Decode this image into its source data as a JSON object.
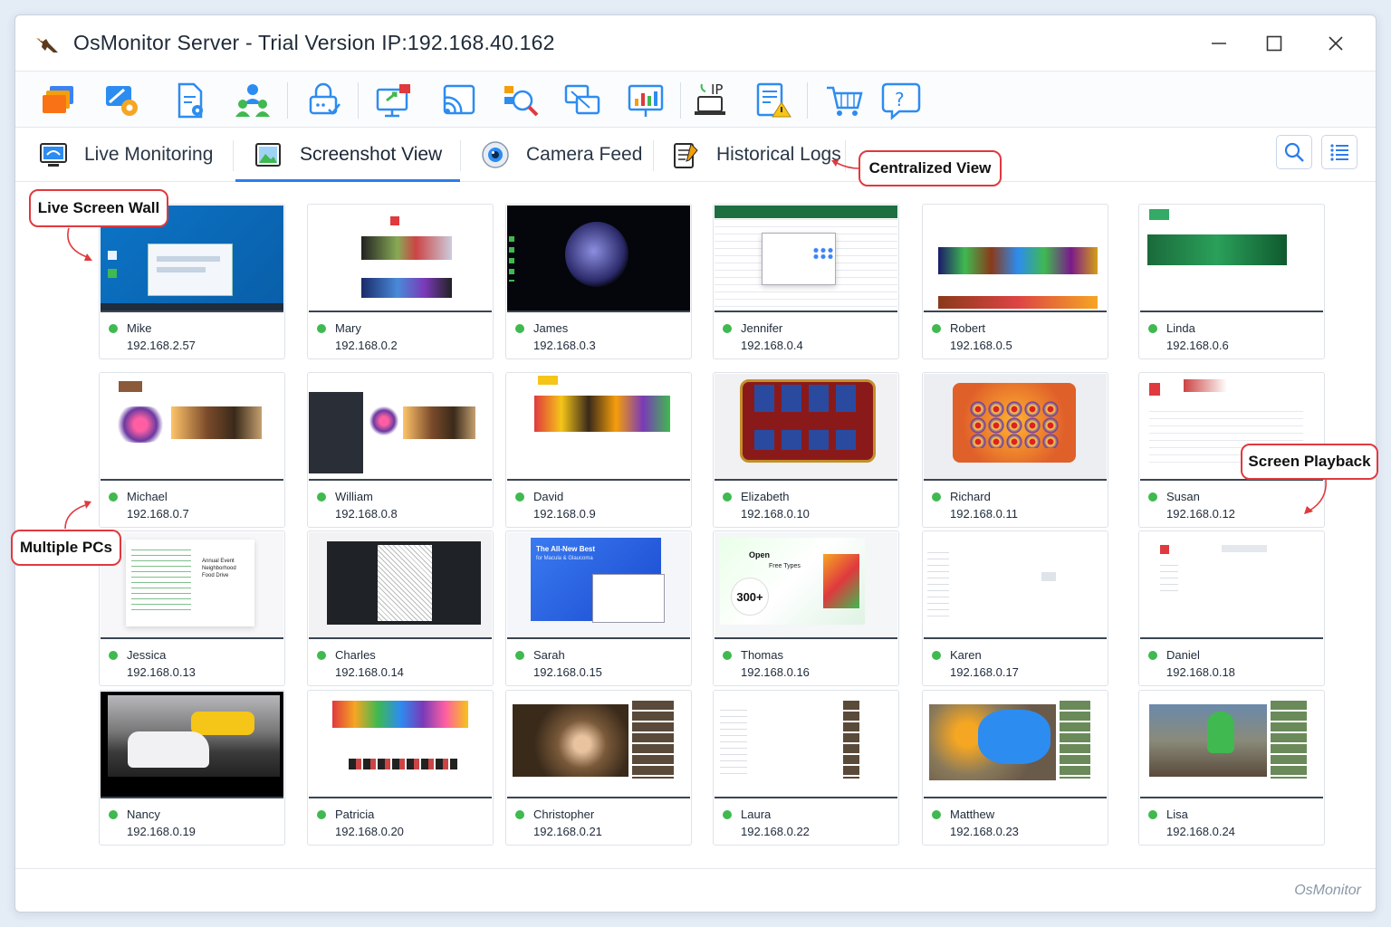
{
  "window": {
    "title": "OsMonitor Server - Trial Version IP:192.168.40.162",
    "minimize_icon": "minimize-icon",
    "maximize_icon": "maximize-icon",
    "close_icon": "close-icon"
  },
  "toolbar": {
    "buttons": [
      {
        "icon": "windows-stack-icon"
      },
      {
        "icon": "magic-settings-icon"
      },
      {
        "icon": "document-settings-icon"
      },
      {
        "icon": "users-icon"
      },
      {
        "icon": "lock-check-icon"
      },
      {
        "icon": "remote-desktop-icon"
      },
      {
        "icon": "broadcast-icon"
      },
      {
        "icon": "search-analyze-icon"
      },
      {
        "icon": "screens-icon"
      },
      {
        "icon": "monitor-chart-icon"
      },
      {
        "icon": "ip-monitor-icon"
      },
      {
        "icon": "log-warning-icon"
      },
      {
        "icon": "cart-icon"
      },
      {
        "icon": "help-icon"
      }
    ],
    "ip_label": "IP",
    "help_label": "?"
  },
  "tabs": [
    {
      "label": "Live Monitoring",
      "icon": "live-monitor-icon"
    },
    {
      "label": "Screenshot View",
      "icon": "picture-icon",
      "active": true
    },
    {
      "label": "Camera Feed",
      "icon": "camera-icon"
    },
    {
      "label": "Historical Logs",
      "icon": "logbook-icon"
    }
  ],
  "tools": {
    "search_icon": "search-icon",
    "list_icon": "list-view-icon"
  },
  "callouts": {
    "centralized": "Centralized View",
    "live_wall": "Live Screen Wall",
    "playback": "Screen Playback",
    "multiple": "Multiple PCs"
  },
  "accent": "#2b7de9",
  "status_online_color": "#3fb950",
  "callout_color": "#e0393e",
  "computers": [
    {
      "name": "Mike",
      "ip": "192.168.2.57",
      "theme": "desktop"
    },
    {
      "name": "Mary",
      "ip": "192.168.0.2",
      "theme": "web"
    },
    {
      "name": "James",
      "ip": "192.168.0.3",
      "theme": "dark-flower"
    },
    {
      "name": "Jennifer",
      "ip": "192.168.0.4",
      "theme": "excel"
    },
    {
      "name": "Robert",
      "ip": "192.168.0.5",
      "theme": "store"
    },
    {
      "name": "Linda",
      "ip": "192.168.0.6",
      "theme": "green-web"
    },
    {
      "name": "Michael",
      "ip": "192.168.0.7",
      "theme": "drone"
    },
    {
      "name": "William",
      "ip": "192.168.0.8",
      "theme": "drone-dark"
    },
    {
      "name": "David",
      "ip": "192.168.0.9",
      "theme": "games"
    },
    {
      "name": "Elizabeth",
      "ip": "192.168.0.10",
      "theme": "poker"
    },
    {
      "name": "Richard",
      "ip": "192.168.0.11",
      "theme": "slots"
    },
    {
      "name": "Susan",
      "ip": "192.168.0.12",
      "theme": "pdf"
    },
    {
      "name": "Jessica",
      "ip": "192.168.0.13",
      "theme": "doc"
    },
    {
      "name": "Charles",
      "ip": "192.168.0.14",
      "theme": "coloring"
    },
    {
      "name": "Sarah",
      "ip": "192.168.0.15",
      "theme": "blue-ad"
    },
    {
      "name": "Thomas",
      "ip": "192.168.0.16",
      "theme": "fonts"
    },
    {
      "name": "Karen",
      "ip": "192.168.0.17",
      "theme": "blank"
    },
    {
      "name": "Daniel",
      "ip": "192.168.0.18",
      "theme": "blank2"
    },
    {
      "name": "Nancy",
      "ip": "192.168.0.19",
      "theme": "car"
    },
    {
      "name": "Patricia",
      "ip": "192.168.0.20",
      "theme": "colorful"
    },
    {
      "name": "Christopher",
      "ip": "192.168.0.21",
      "theme": "video"
    },
    {
      "name": "Laura",
      "ip": "192.168.0.22",
      "theme": "youtube"
    },
    {
      "name": "Matthew",
      "ip": "192.168.0.23",
      "theme": "blue-shark"
    },
    {
      "name": "Lisa",
      "ip": "192.168.0.24",
      "theme": "android"
    }
  ],
  "thumb_text": {
    "annual": "Annual Event Neighborhood Food Drive",
    "sarah_headline": "The All-New Best",
    "sarah_sub": "for Macula & Glaucoma",
    "open": "Open",
    "free_types": "Free Types",
    "count": "300+"
  },
  "footer": {
    "brand": "OsMonitor"
  }
}
